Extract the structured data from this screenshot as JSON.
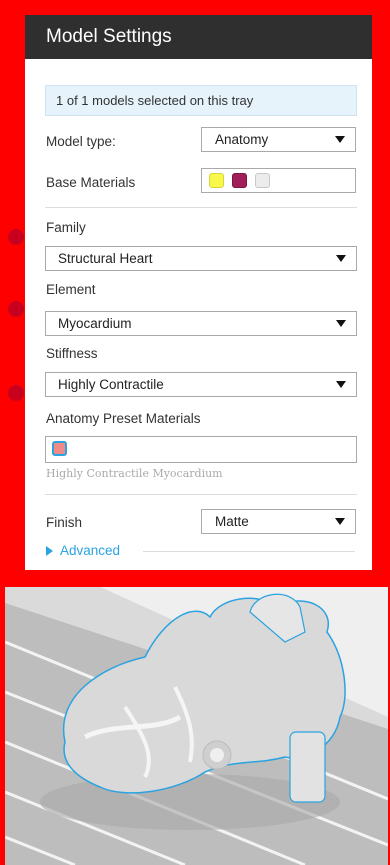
{
  "header": {
    "title": "Model Settings"
  },
  "info": {
    "text": "1 of 1 models selected on this tray"
  },
  "model_type": {
    "label": "Model type:",
    "value": "Anatomy"
  },
  "base_materials": {
    "label": "Base Materials",
    "swatches": [
      "#f8f84a",
      "#a01e5a",
      "#ececec"
    ]
  },
  "family": {
    "label": "Family",
    "value": "Structural Heart"
  },
  "element": {
    "label": "Element",
    "value": "Myocardium"
  },
  "stiffness": {
    "label": "Stiffness",
    "value": "Highly Contractile"
  },
  "preset": {
    "label": "Anatomy Preset Materials",
    "swatch": "#f08a87",
    "caption": "Highly Contractile Myocardium"
  },
  "finish": {
    "label": "Finish",
    "value": "Matte"
  },
  "advanced": {
    "label": "Advanced"
  },
  "colors": {
    "accent": "#2aa3e0",
    "frame": "#ff0000",
    "header": "#2f2f2f"
  }
}
